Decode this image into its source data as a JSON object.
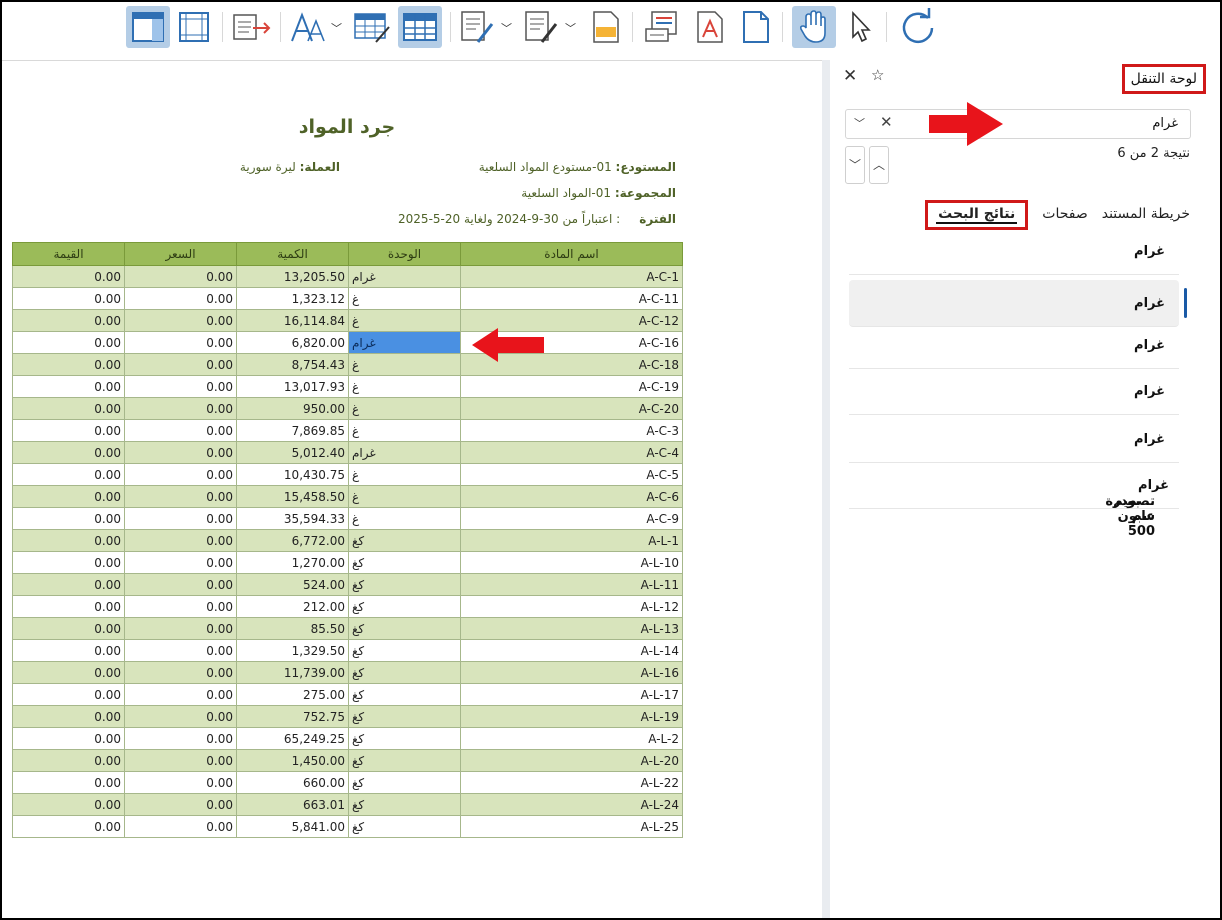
{
  "nav": {
    "title": "لوحة التنقل",
    "search_value": "غرام",
    "result_count": "نتيجة 2 من 6",
    "tabs": [
      "خريطة المستند",
      "صفحات",
      "نتائج البحث"
    ],
    "results": [
      "غرام",
      "غرام",
      "غرام",
      "غرام",
      "غرام"
    ],
    "snippet_before": "...بودرة سبون 500 ",
    "snippet_bold": "غرام",
    "snippet_after": " تصميم عام"
  },
  "report": {
    "title": "جرد المواد",
    "warehouse_label": "المستودع:",
    "warehouse_value": "01-مستودع المواد السلعية",
    "currency_label": "العملة:",
    "currency_value": "ليرة سورية",
    "group_label": "المجموعة:",
    "group_value": "01-المواد السلعية",
    "period_label": "الفترة",
    "period_value": ": اعتباراً من 30-9-2024 ولغاية 20-5-2025"
  },
  "table": {
    "headers": [
      "القيمة",
      "السعر",
      "الكمية",
      "الوحدة",
      "اسم المادة"
    ],
    "rows": [
      [
        "0.00",
        "0.00",
        "13,205.50",
        "غرام",
        "A-C-1"
      ],
      [
        "0.00",
        "0.00",
        "1,323.12",
        "غ",
        "A-C-11"
      ],
      [
        "0.00",
        "0.00",
        "16,114.84",
        "غ",
        "A-C-12"
      ],
      [
        "0.00",
        "0.00",
        "6,820.00",
        "غرام",
        "A-C-16"
      ],
      [
        "0.00",
        "0.00",
        "8,754.43",
        "غ",
        "A-C-18"
      ],
      [
        "0.00",
        "0.00",
        "13,017.93",
        "غ",
        "A-C-19"
      ],
      [
        "0.00",
        "0.00",
        "950.00",
        "غ",
        "A-C-20"
      ],
      [
        "0.00",
        "0.00",
        "7,869.85",
        "غ",
        "A-C-3"
      ],
      [
        "0.00",
        "0.00",
        "5,012.40",
        "غرام",
        "A-C-4"
      ],
      [
        "0.00",
        "0.00",
        "10,430.75",
        "غ",
        "A-C-5"
      ],
      [
        "0.00",
        "0.00",
        "15,458.50",
        "غ",
        "A-C-6"
      ],
      [
        "0.00",
        "0.00",
        "35,594.33",
        "غ",
        "A-C-9"
      ],
      [
        "0.00",
        "0.00",
        "6,772.00",
        "كغ",
        "A-L-1"
      ],
      [
        "0.00",
        "0.00",
        "1,270.00",
        "كغ",
        "A-L-10"
      ],
      [
        "0.00",
        "0.00",
        "524.00",
        "كغ",
        "A-L-11"
      ],
      [
        "0.00",
        "0.00",
        "212.00",
        "كغ",
        "A-L-12"
      ],
      [
        "0.00",
        "0.00",
        "85.50",
        "كغ",
        "A-L-13"
      ],
      [
        "0.00",
        "0.00",
        "1,329.50",
        "كغ",
        "A-L-14"
      ],
      [
        "0.00",
        "0.00",
        "11,739.00",
        "كغ",
        "A-L-16"
      ],
      [
        "0.00",
        "0.00",
        "275.00",
        "كغ",
        "A-L-17"
      ],
      [
        "0.00",
        "0.00",
        "752.75",
        "كغ",
        "A-L-19"
      ],
      [
        "0.00",
        "0.00",
        "65,249.25",
        "كغ",
        "A-L-2"
      ],
      [
        "0.00",
        "0.00",
        "1,450.00",
        "كغ",
        "A-L-20"
      ],
      [
        "0.00",
        "0.00",
        "660.00",
        "كغ",
        "A-L-22"
      ],
      [
        "0.00",
        "0.00",
        "663.01",
        "كغ",
        "A-L-24"
      ],
      [
        "0.00",
        "0.00",
        "5,841.00",
        "كغ",
        "A-L-25"
      ]
    ],
    "highlight_row": 3
  },
  "colors": {
    "header_green": "#9bbb59",
    "alt_row": "#d8e4bc",
    "title_green": "#4f6228",
    "highlight": "#4a90e2",
    "annotation_red": "#e8141b"
  },
  "toolbar_icons": [
    "layout-icon",
    "margins-icon",
    "export-icon",
    "font-icon",
    "table-edit-icon",
    "table-icon",
    "edit-doc-icon",
    "edit-doc2-icon",
    "note-icon",
    "print-list-icon",
    "pdf-icon",
    "page-icon",
    "hand-tool-icon",
    "pointer-icon",
    "refresh-icon"
  ]
}
